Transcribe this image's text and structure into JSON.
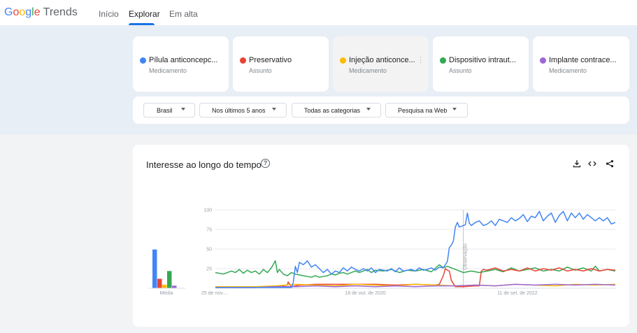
{
  "header": {
    "logo_google": "Google",
    "logo_trends": "Trends",
    "nav": [
      {
        "label": "Início",
        "active": false
      },
      {
        "label": "Explorar",
        "active": true
      },
      {
        "label": "Em alta",
        "active": false
      }
    ]
  },
  "terms": [
    {
      "name": "Pílula anticoncepc...",
      "type": "Medicamento",
      "color": "#4285f4"
    },
    {
      "name": "Preservativo",
      "type": "Assunto",
      "color": "#ea4335"
    },
    {
      "name": "Injeção anticonce...",
      "type": "Medicamento",
      "color": "#fbbc04",
      "more_icon": "more-vert-icon"
    },
    {
      "name": "Dispositivo intraut...",
      "type": "Assunto",
      "color": "#34a853"
    },
    {
      "name": "Implante contrace...",
      "type": "Medicamento",
      "color": "#9c66d8"
    }
  ],
  "filters": [
    {
      "label": "Brasil"
    },
    {
      "label": "Nos últimos 5 anos"
    },
    {
      "label": "Todas as categorias"
    },
    {
      "label": "Pesquisa na Web"
    }
  ],
  "chart_card": {
    "title": "Interesse ao longo do tempo",
    "help_icon": "help-circle-icon",
    "tools": [
      "download-icon",
      "embed-code-icon",
      "share-icon"
    ]
  },
  "chart_data": {
    "type": "line",
    "title": "",
    "xlabel": "",
    "ylabel": "",
    "ylim": [
      0,
      100
    ],
    "yticks": [
      "100",
      "75",
      "50",
      "25"
    ],
    "xticks": [
      "25 de nov....",
      "18 de out. de 2020",
      "11 de set. de 2022"
    ],
    "annotation": "Observação",
    "grid": true,
    "legend": "none",
    "x_start": "2018-11-25",
    "x_end": "2023-11-12",
    "average_bars": {
      "label": "Média",
      "values": [
        45,
        11,
        4,
        20,
        3
      ]
    },
    "series": [
      {
        "color": "#4285f4",
        "values": [
          [
            0.0,
            1
          ],
          [
            0.19,
            1
          ],
          [
            0.192,
            2
          ],
          [
            0.195,
            8
          ],
          [
            0.2,
            28
          ],
          [
            0.205,
            20
          ],
          [
            0.21,
            33
          ],
          [
            0.22,
            30
          ],
          [
            0.23,
            35
          ],
          [
            0.24,
            27
          ],
          [
            0.25,
            30
          ],
          [
            0.26,
            25
          ],
          [
            0.27,
            20
          ],
          [
            0.28,
            24
          ],
          [
            0.29,
            18
          ],
          [
            0.3,
            22
          ],
          [
            0.31,
            20
          ],
          [
            0.32,
            26
          ],
          [
            0.33,
            22
          ],
          [
            0.34,
            27
          ],
          [
            0.35,
            24
          ],
          [
            0.36,
            22
          ],
          [
            0.37,
            25
          ],
          [
            0.38,
            22
          ],
          [
            0.39,
            26
          ],
          [
            0.4,
            20
          ],
          [
            0.41,
            24
          ],
          [
            0.42,
            23
          ],
          [
            0.43,
            22
          ],
          [
            0.44,
            25
          ],
          [
            0.45,
            21
          ],
          [
            0.46,
            26
          ],
          [
            0.47,
            22
          ],
          [
            0.48,
            23
          ],
          [
            0.49,
            24
          ],
          [
            0.5,
            22
          ],
          [
            0.51,
            26
          ],
          [
            0.52,
            23
          ],
          [
            0.53,
            24
          ],
          [
            0.54,
            26
          ],
          [
            0.55,
            23
          ],
          [
            0.56,
            27
          ],
          [
            0.57,
            26
          ],
          [
            0.575,
            30
          ],
          [
            0.58,
            34
          ],
          [
            0.585,
            52
          ],
          [
            0.59,
            55
          ],
          [
            0.595,
            60
          ],
          [
            0.6,
            78
          ],
          [
            0.605,
            84
          ],
          [
            0.61,
            78
          ],
          [
            0.62,
            80
          ],
          [
            0.625,
            81
          ],
          [
            0.63,
            96
          ],
          [
            0.635,
            83
          ],
          [
            0.64,
            80
          ],
          [
            0.65,
            84
          ],
          [
            0.66,
            86
          ],
          [
            0.67,
            80
          ],
          [
            0.68,
            82
          ],
          [
            0.69,
            86
          ],
          [
            0.7,
            80
          ],
          [
            0.71,
            88
          ],
          [
            0.72,
            86
          ],
          [
            0.73,
            84
          ],
          [
            0.74,
            90
          ],
          [
            0.75,
            86
          ],
          [
            0.76,
            89
          ],
          [
            0.77,
            94
          ],
          [
            0.78,
            85
          ],
          [
            0.79,
            92
          ],
          [
            0.8,
            90
          ],
          [
            0.81,
            98
          ],
          [
            0.82,
            86
          ],
          [
            0.83,
            92
          ],
          [
            0.84,
            96
          ],
          [
            0.85,
            84
          ],
          [
            0.86,
            93
          ],
          [
            0.87,
            98
          ],
          [
            0.88,
            86
          ],
          [
            0.89,
            96
          ],
          [
            0.9,
            90
          ],
          [
            0.91,
            96
          ],
          [
            0.92,
            88
          ],
          [
            0.93,
            94
          ],
          [
            0.94,
            90
          ],
          [
            0.95,
            86
          ],
          [
            0.96,
            90
          ],
          [
            0.97,
            86
          ],
          [
            0.98,
            90
          ],
          [
            0.99,
            82
          ],
          [
            1.0,
            84
          ]
        ]
      },
      {
        "color": "#ea4335",
        "values": [
          [
            0.0,
            1
          ],
          [
            0.1,
            1
          ],
          [
            0.15,
            2
          ],
          [
            0.18,
            4
          ],
          [
            0.182,
            8
          ],
          [
            0.19,
            2
          ],
          [
            0.21,
            4
          ],
          [
            0.25,
            5
          ],
          [
            0.3,
            5
          ],
          [
            0.35,
            5
          ],
          [
            0.4,
            5
          ],
          [
            0.45,
            4
          ],
          [
            0.5,
            5
          ],
          [
            0.55,
            4
          ],
          [
            0.56,
            5
          ],
          [
            0.57,
            16
          ],
          [
            0.575,
            25
          ],
          [
            0.58,
            23
          ],
          [
            0.585,
            22
          ],
          [
            0.59,
            10
          ],
          [
            0.6,
            2
          ],
          [
            0.62,
            2
          ],
          [
            0.65,
            3
          ],
          [
            0.66,
            3
          ],
          [
            0.665,
            22
          ],
          [
            0.67,
            24
          ],
          [
            0.68,
            23
          ],
          [
            0.7,
            26
          ],
          [
            0.72,
            22
          ],
          [
            0.74,
            24
          ],
          [
            0.76,
            22
          ],
          [
            0.78,
            26
          ],
          [
            0.8,
            22
          ],
          [
            0.82,
            25
          ],
          [
            0.84,
            23
          ],
          [
            0.86,
            26
          ],
          [
            0.88,
            22
          ],
          [
            0.9,
            24
          ],
          [
            0.92,
            22
          ],
          [
            0.94,
            25
          ],
          [
            0.96,
            22
          ],
          [
            0.98,
            24
          ],
          [
            1.0,
            23
          ]
        ]
      },
      {
        "color": "#fbbc04",
        "values": [
          [
            0.0,
            2
          ],
          [
            0.1,
            2
          ],
          [
            0.15,
            3
          ],
          [
            0.2,
            5
          ],
          [
            0.25,
            4
          ],
          [
            0.3,
            3
          ],
          [
            0.35,
            5
          ],
          [
            0.4,
            4
          ],
          [
            0.45,
            3
          ],
          [
            0.5,
            5
          ],
          [
            0.55,
            4
          ],
          [
            0.6,
            3
          ],
          [
            0.65,
            4
          ],
          [
            0.7,
            3
          ],
          [
            0.75,
            5
          ],
          [
            0.8,
            4
          ],
          [
            0.85,
            3
          ],
          [
            0.9,
            5
          ],
          [
            0.95,
            4
          ],
          [
            1.0,
            5
          ]
        ]
      },
      {
        "color": "#34a853",
        "values": [
          [
            0.0,
            20
          ],
          [
            0.02,
            18
          ],
          [
            0.04,
            22
          ],
          [
            0.05,
            20
          ],
          [
            0.06,
            24
          ],
          [
            0.07,
            19
          ],
          [
            0.08,
            23
          ],
          [
            0.09,
            20
          ],
          [
            0.1,
            22
          ],
          [
            0.11,
            18
          ],
          [
            0.12,
            24
          ],
          [
            0.13,
            20
          ],
          [
            0.14,
            26
          ],
          [
            0.15,
            35
          ],
          [
            0.155,
            20
          ],
          [
            0.16,
            24
          ],
          [
            0.17,
            18
          ],
          [
            0.18,
            16
          ],
          [
            0.19,
            20
          ],
          [
            0.2,
            18
          ],
          [
            0.21,
            17
          ],
          [
            0.22,
            16
          ],
          [
            0.23,
            15
          ],
          [
            0.24,
            14
          ],
          [
            0.25,
            16
          ],
          [
            0.26,
            14
          ],
          [
            0.27,
            15
          ],
          [
            0.28,
            16
          ],
          [
            0.29,
            18
          ],
          [
            0.3,
            17
          ],
          [
            0.31,
            19
          ],
          [
            0.32,
            20
          ],
          [
            0.33,
            18
          ],
          [
            0.34,
            20
          ],
          [
            0.35,
            22
          ],
          [
            0.36,
            20
          ],
          [
            0.37,
            22
          ],
          [
            0.38,
            24
          ],
          [
            0.39,
            20
          ],
          [
            0.4,
            23
          ],
          [
            0.42,
            22
          ],
          [
            0.44,
            24
          ],
          [
            0.46,
            20
          ],
          [
            0.48,
            23
          ],
          [
            0.5,
            22
          ],
          [
            0.52,
            24
          ],
          [
            0.54,
            21
          ],
          [
            0.56,
            30
          ],
          [
            0.57,
            26
          ],
          [
            0.58,
            28
          ],
          [
            0.59,
            26
          ],
          [
            0.6,
            24
          ],
          [
            0.62,
            20
          ],
          [
            0.64,
            22
          ],
          [
            0.66,
            20
          ],
          [
            0.68,
            22
          ],
          [
            0.7,
            24
          ],
          [
            0.72,
            21
          ],
          [
            0.74,
            26
          ],
          [
            0.76,
            22
          ],
          [
            0.78,
            24
          ],
          [
            0.8,
            26
          ],
          [
            0.82,
            22
          ],
          [
            0.84,
            24
          ],
          [
            0.86,
            22
          ],
          [
            0.88,
            27
          ],
          [
            0.9,
            23
          ],
          [
            0.92,
            26
          ],
          [
            0.94,
            22
          ],
          [
            0.95,
            28
          ],
          [
            0.96,
            22
          ],
          [
            0.98,
            24
          ],
          [
            1.0,
            22
          ]
        ]
      },
      {
        "color": "#9c66d8",
        "values": [
          [
            0.0,
            1
          ],
          [
            0.1,
            1
          ],
          [
            0.15,
            2
          ],
          [
            0.2,
            2
          ],
          [
            0.25,
            3
          ],
          [
            0.3,
            2
          ],
          [
            0.35,
            3
          ],
          [
            0.4,
            2
          ],
          [
            0.45,
            3
          ],
          [
            0.5,
            2
          ],
          [
            0.55,
            3
          ],
          [
            0.6,
            3
          ],
          [
            0.65,
            4
          ],
          [
            0.7,
            3
          ],
          [
            0.75,
            5
          ],
          [
            0.8,
            4
          ],
          [
            0.85,
            5
          ],
          [
            0.9,
            4
          ],
          [
            0.95,
            5
          ],
          [
            1.0,
            4
          ]
        ]
      }
    ]
  }
}
